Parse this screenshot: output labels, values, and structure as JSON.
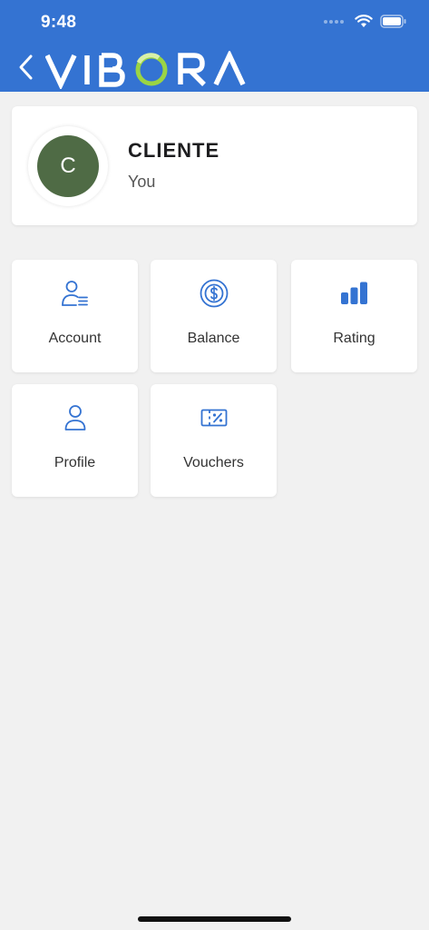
{
  "status_bar": {
    "time": "9:48"
  },
  "header": {
    "brand": "VIBORA",
    "brand_colors": {
      "white": "#ffffff",
      "accent_green": "#9bd443",
      "background": "#3473d2"
    }
  },
  "user_card": {
    "avatar_initial": "C",
    "name": "CLIENTE",
    "subtitle": "You",
    "avatar_color": "#4f6b45"
  },
  "menu": [
    {
      "label": "Account",
      "icon": "account-icon"
    },
    {
      "label": "Balance",
      "icon": "balance-icon"
    },
    {
      "label": "Rating",
      "icon": "rating-icon"
    },
    {
      "label": "Profile",
      "icon": "profile-icon"
    },
    {
      "label": "Vouchers",
      "icon": "voucher-icon"
    }
  ]
}
